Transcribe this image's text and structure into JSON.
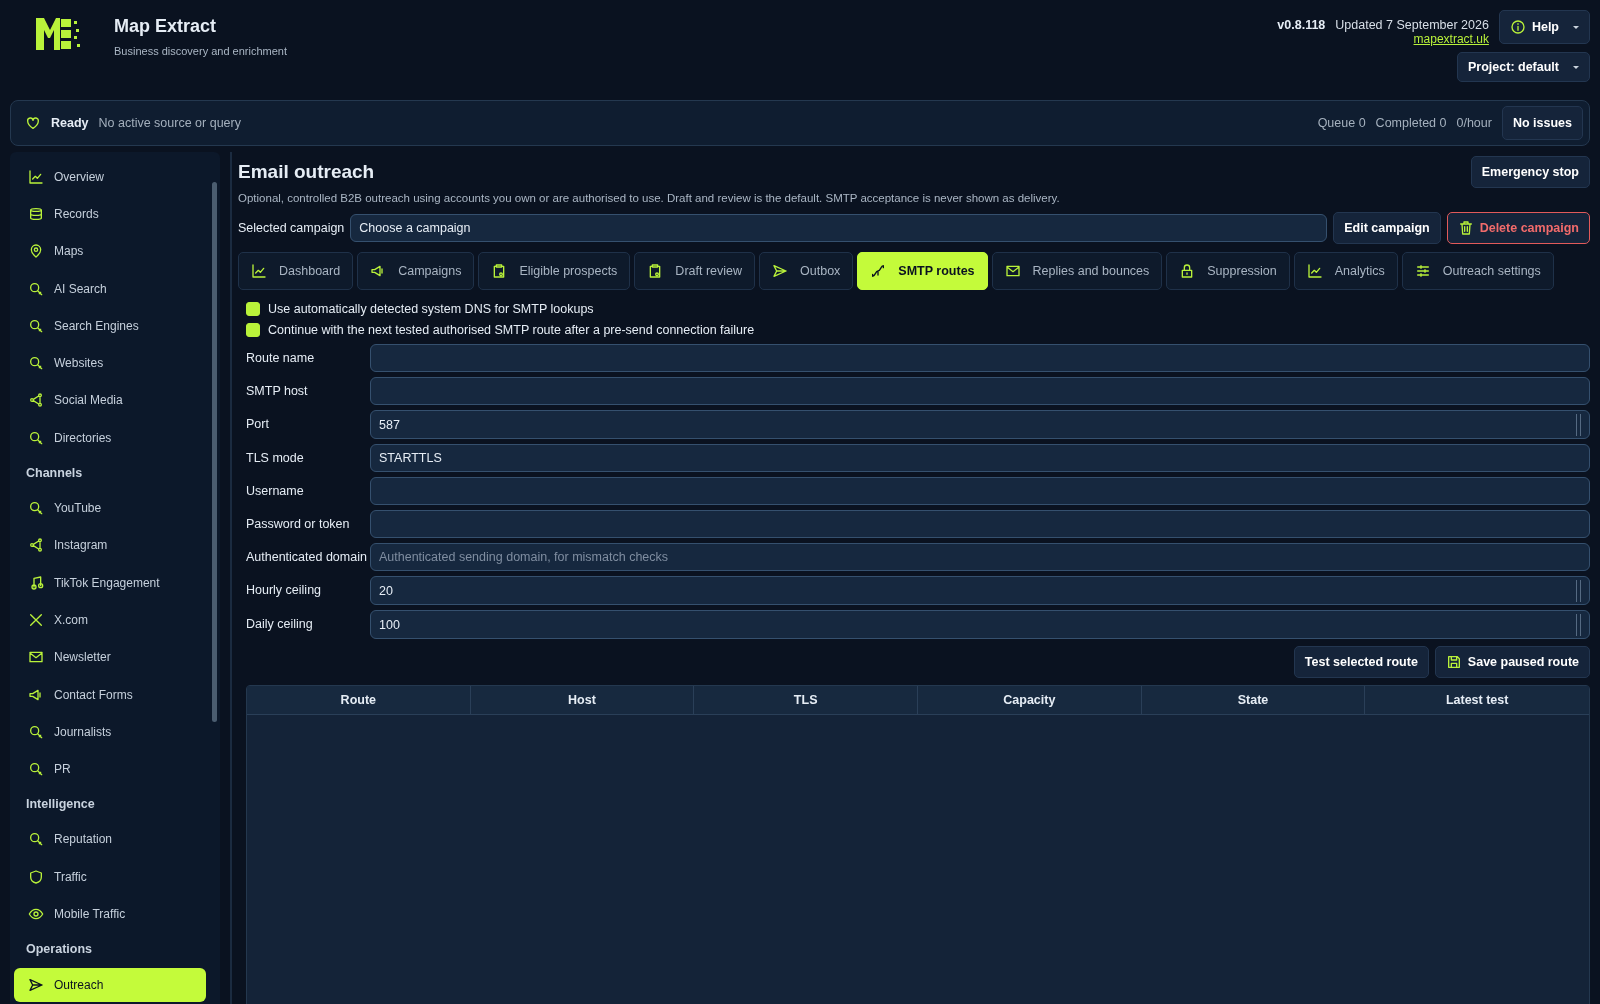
{
  "app": {
    "title": "Map Extract",
    "subtitle": "Business discovery and enrichment",
    "version": "v0.8.118",
    "updated": "Updated 7 September 2026",
    "link": "mapextract.uk",
    "help": "Help",
    "project": "Project: default"
  },
  "status_bar": {
    "state": "Ready",
    "message": "No active source or query",
    "queue": "Queue 0",
    "completed": "Completed 0",
    "rate": "0/hour",
    "issues": "No issues"
  },
  "sidebar": {
    "groups": [
      {
        "items": [
          {
            "label": "Overview",
            "selected": false
          },
          {
            "label": "Records",
            "selected": false
          },
          {
            "label": "Maps",
            "selected": false
          },
          {
            "label": "AI Search",
            "selected": false
          },
          {
            "label": "Search Engines",
            "selected": false
          },
          {
            "label": "Websites",
            "selected": false
          },
          {
            "label": "Social Media",
            "selected": false
          },
          {
            "label": "Directories",
            "selected": false
          }
        ]
      },
      {
        "heading": "Channels",
        "items": [
          {
            "label": "YouTube",
            "selected": false
          },
          {
            "label": "Instagram",
            "selected": false
          },
          {
            "label": "TikTok Engagement",
            "selected": false
          },
          {
            "label": "X.com",
            "selected": false
          },
          {
            "label": "Newsletter",
            "selected": false
          },
          {
            "label": "Contact Forms",
            "selected": false
          },
          {
            "label": "Journalists",
            "selected": false
          },
          {
            "label": "PR",
            "selected": false
          }
        ]
      },
      {
        "heading": "Intelligence",
        "items": [
          {
            "label": "Reputation",
            "selected": false
          },
          {
            "label": "Traffic",
            "selected": false
          },
          {
            "label": "Mobile Traffic",
            "selected": false
          }
        ]
      },
      {
        "heading": "Operations",
        "items": [
          {
            "label": "Outreach",
            "selected": true
          }
        ]
      }
    ]
  },
  "page": {
    "title": "Email outreach",
    "description": "Optional, controlled B2B outreach using accounts you own or are authorised to use. Draft and review is the default. SMTP acceptance is never shown as delivery.",
    "emergency_button": "Emergency stop",
    "campaign": {
      "label": "Selected campaign",
      "value": "Choose a campaign",
      "edit_button": "Edit campaign",
      "delete_button": "Delete campaign"
    },
    "tabs": [
      {
        "label": "Dashboard",
        "selected": false
      },
      {
        "label": "Campaigns",
        "selected": false
      },
      {
        "label": "Eligible prospects",
        "selected": false
      },
      {
        "label": "Draft review",
        "selected": false
      },
      {
        "label": "Outbox",
        "selected": false
      },
      {
        "label": "SMTP routes",
        "selected": true
      },
      {
        "label": "Replies and bounces",
        "selected": false
      },
      {
        "label": "Suppression",
        "selected": false
      },
      {
        "label": "Analytics",
        "selected": false
      },
      {
        "label": "Outreach settings",
        "selected": false
      }
    ],
    "checkboxes": [
      {
        "label": "Use automatically detected system DNS for SMTP lookups",
        "checked": true
      },
      {
        "label": "Continue with the next tested authorised SMTP route after a pre-send connection failure",
        "checked": true
      }
    ],
    "fields": [
      {
        "label": "Route name",
        "kind": "text"
      },
      {
        "label": "SMTP host",
        "kind": "text"
      },
      {
        "label": "Port",
        "kind": "number",
        "value": "587"
      },
      {
        "label": "TLS mode",
        "kind": "select",
        "value": "STARTTLS"
      },
      {
        "label": "Username",
        "kind": "text"
      },
      {
        "label": "Password or token",
        "kind": "text"
      },
      {
        "label": "Authenticated domain",
        "kind": "text",
        "placeholder": "Authenticated sending domain, for mismatch checks"
      },
      {
        "label": "Hourly ceiling",
        "kind": "number",
        "value": "20"
      },
      {
        "label": "Daily ceiling",
        "kind": "number",
        "value": "100"
      }
    ],
    "test_button": "Test selected route",
    "save_button": "Save paused route",
    "table": {
      "columns": [
        "Route",
        "Host",
        "TLS",
        "Capacity",
        "State",
        "Latest test"
      ]
    }
  }
}
